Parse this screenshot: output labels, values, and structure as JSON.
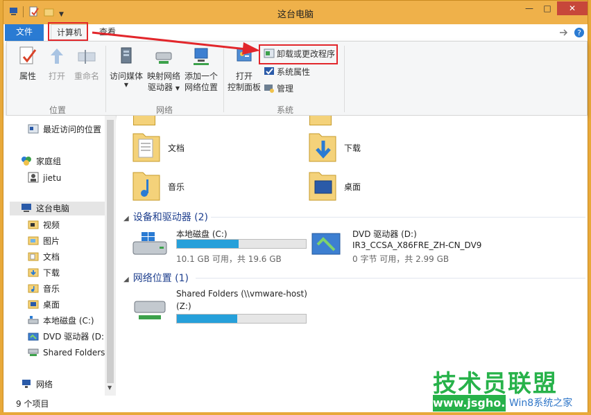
{
  "window": {
    "title": "这台电脑",
    "close_glyph": "✕",
    "restore_glyph": "□",
    "minimize_glyph": "—"
  },
  "tabs": {
    "file": "文件",
    "computer": "计算机",
    "view": "查看"
  },
  "ribbon": {
    "location": {
      "label": "位置",
      "properties": "属性",
      "open": "打开",
      "rename": "重命名"
    },
    "network": {
      "label": "网络",
      "access_media": "访问媒体",
      "map_drive_1": "映射网络",
      "map_drive_2": "驱动器",
      "add_location_1": "添加一个",
      "add_location_2": "网络位置"
    },
    "system": {
      "label": "系统",
      "open_cp_1": "打开",
      "open_cp_2": "控制面板",
      "uninstall": "卸载或更改程序",
      "sys_props": "系统属性",
      "manage": "管理"
    }
  },
  "nav": {
    "recent": "最近访问的位置",
    "homegroup": "家庭组",
    "user": "jietu",
    "this_pc": "这台电脑",
    "videos": "视频",
    "pictures": "图片",
    "documents": "文档",
    "downloads": "下载",
    "music": "音乐",
    "desktop": "桌面",
    "local_disk": "本地磁盘 (C:)",
    "dvd": "DVD 驱动器 (D:)",
    "shared": "Shared Folders",
    "network": "网络"
  },
  "content": {
    "folders": [
      {
        "label": "文档"
      },
      {
        "label": "下载"
      },
      {
        "label": "音乐"
      },
      {
        "label": "桌面"
      }
    ],
    "devices_header": "设备和驱动器 (2)",
    "network_header": "网络位置 (1)",
    "local_disk": {
      "name": "本地磁盘 (C:)",
      "free": "10.1 GB 可用，共 19.6 GB",
      "used_fraction": 0.48
    },
    "dvd": {
      "name": "DVD 驱动器 (D:)",
      "volume": "IR3_CCSA_X86FRE_ZH-CN_DV9",
      "free": "0 字节 可用，共 2.99 GB"
    },
    "shared": {
      "name_1": "Shared Folders (\\\\vmware-host)",
      "name_2": "(Z:)",
      "used_fraction": 0.47
    }
  },
  "status": {
    "items": "9 个项目"
  },
  "watermark": {
    "big": "技术员联盟",
    "url": "www.jsgho.com",
    "sub": "Win8系统之家"
  },
  "colors": {
    "accent": "#2a7bd3",
    "titlebar": "#efb14a",
    "highlight": "#e2262b",
    "bar_fill": "#26a0da",
    "watermark_green": "#27b24a"
  }
}
